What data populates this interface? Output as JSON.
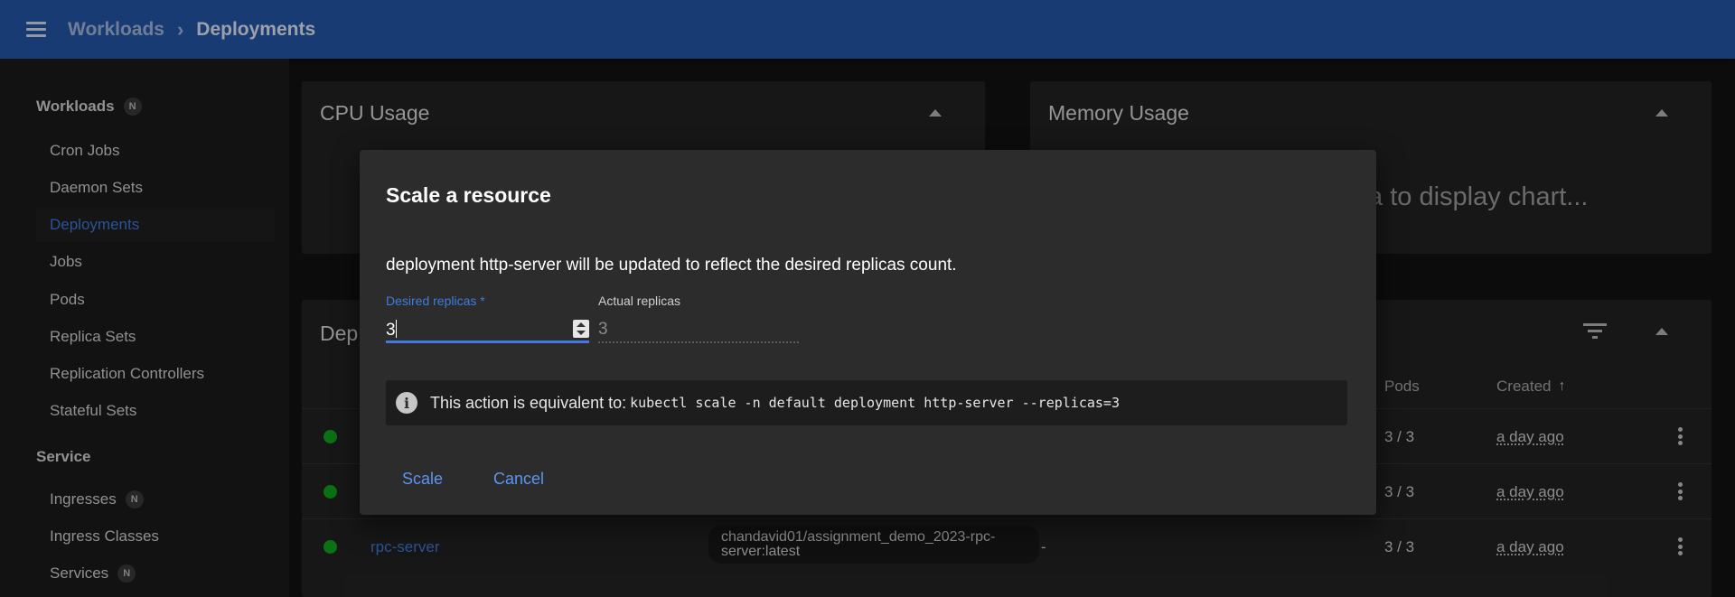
{
  "header": {
    "crumb_parent": "Workloads",
    "crumb_separator": "›",
    "crumb_current": "Deployments"
  },
  "sidebar": {
    "workloads_title": "Workloads",
    "workloads_badge": "N",
    "workload_items": [
      "Cron Jobs",
      "Daemon Sets",
      "Deployments",
      "Jobs",
      "Pods",
      "Replica Sets",
      "Replication Controllers",
      "Stateful Sets"
    ],
    "active_item": "Deployments",
    "service_title": "Service",
    "service_items": [
      {
        "label": "Ingresses",
        "badge": "N"
      },
      {
        "label": "Ingress Classes",
        "badge": ""
      },
      {
        "label": "Services",
        "badge": "N"
      }
    ]
  },
  "cpu_card": {
    "title": "CPU Usage"
  },
  "memory_card": {
    "title": "Memory Usage",
    "placeholder": "ta to display chart..."
  },
  "deployments_card": {
    "title_partial": "Dep",
    "headers": {
      "pods": "Pods",
      "created": "Created"
    },
    "sort_icon": "arrow-up-icon",
    "rows": [
      {
        "name": "",
        "image": "",
        "extra": "",
        "pods": "3 / 3",
        "created": "a day ago"
      },
      {
        "name": "",
        "image": "",
        "extra": "",
        "pods": "3 / 3",
        "created": "a day ago"
      },
      {
        "name": "rpc-server",
        "image": "chandavid01/assignment_demo_2023-rpc-server:latest",
        "extra": "-",
        "pods": "3 / 3",
        "created": "a day ago"
      }
    ]
  },
  "dialog": {
    "title": "Scale a resource",
    "message": "deployment http-server will be updated to reflect the desired replicas count.",
    "desired_label": "Desired replicas *",
    "desired_value": "3",
    "actual_label": "Actual replicas",
    "actual_value": "3",
    "info_text": "This action is equivalent to:",
    "info_command": "kubectl scale -n default deployment http-server --replicas=3",
    "scale_label": "Scale",
    "cancel_label": "Cancel"
  },
  "colors": {
    "topbar": "#2557ac",
    "accent": "#3f7be0",
    "status_ok": "#13a51e"
  }
}
